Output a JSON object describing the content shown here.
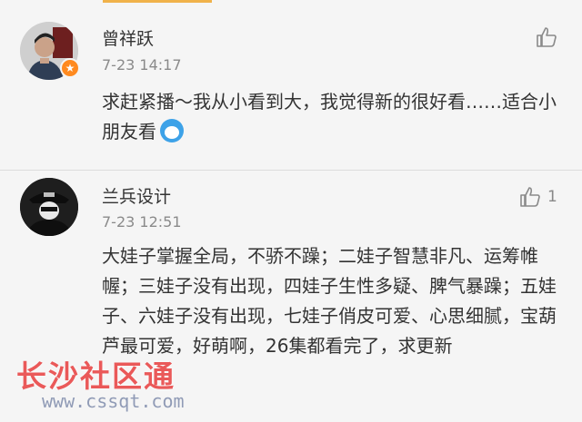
{
  "comments": [
    {
      "username": "曾祥跃",
      "time": "7-23 14:17",
      "like_count": "",
      "text": "求赶紧播～我从小看到大，我觉得新的很好看……适合小朋友看",
      "badge_icon": "flag-badge-icon"
    },
    {
      "username": "兰兵设计",
      "time": "7-23 12:51",
      "like_count": "1",
      "text": "大娃子掌握全局，不骄不躁；二娃子智慧非凡、运筹帷幄；三娃子没有出现，四娃子生性多疑、脾气暴躁；五娃子、六娃子没有出现，七娃子俏皮可爱、心思细腻，宝葫芦最可爱，好萌啊，26集都看完了，求更新"
    }
  ],
  "watermark": {
    "title": "长沙社区通",
    "url": "www.cssqt.com"
  },
  "colors": {
    "accent": "#f0b24a",
    "badge": "#ff8a1f",
    "text": "#333333",
    "muted": "#8a8a8a"
  }
}
